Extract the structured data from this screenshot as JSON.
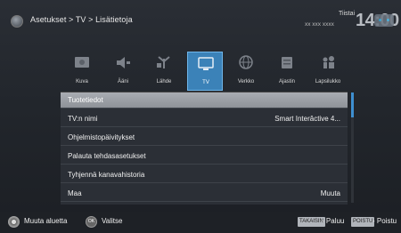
{
  "header": {
    "breadcrumb": "Asetukset > TV > Lisätietoja",
    "day": "Tiistai",
    "date": "xx xxx xxxx",
    "clock": "14:00"
  },
  "categories": [
    {
      "label": "Kuva",
      "icon": "picture-icon"
    },
    {
      "label": "Ääni",
      "icon": "sound-icon"
    },
    {
      "label": "Lähde",
      "icon": "source-icon"
    },
    {
      "label": "TV",
      "icon": "tv-icon",
      "active": true
    },
    {
      "label": "Verkko",
      "icon": "network-icon"
    },
    {
      "label": "Ajastin",
      "icon": "timer-icon"
    },
    {
      "label": "Lapsilukko",
      "icon": "parental-lock-icon"
    }
  ],
  "menu": [
    {
      "label": "Tuotetiedot",
      "value": ""
    },
    {
      "label": "TV:n nimi",
      "value": "Smart Interâctive 4..."
    },
    {
      "label": "Ohjelmistopäivitykset",
      "value": ""
    },
    {
      "label": "Palauta tehdasasetukset",
      "value": ""
    },
    {
      "label": "Tyhjennä kanavahistoria",
      "value": ""
    },
    {
      "label": "Maa",
      "value": "Muuta"
    }
  ],
  "footer": {
    "move_label": "Muuta aluetta",
    "ok_key": "OK",
    "select_label": "Valitse",
    "back_key": "TAKAISIN",
    "back_label": "- Paluu",
    "exit_key": "POISTU",
    "exit_label": "- Poistu"
  },
  "colors": {
    "accent": "#3b82b8",
    "selected_row": "#9a9ea4"
  }
}
